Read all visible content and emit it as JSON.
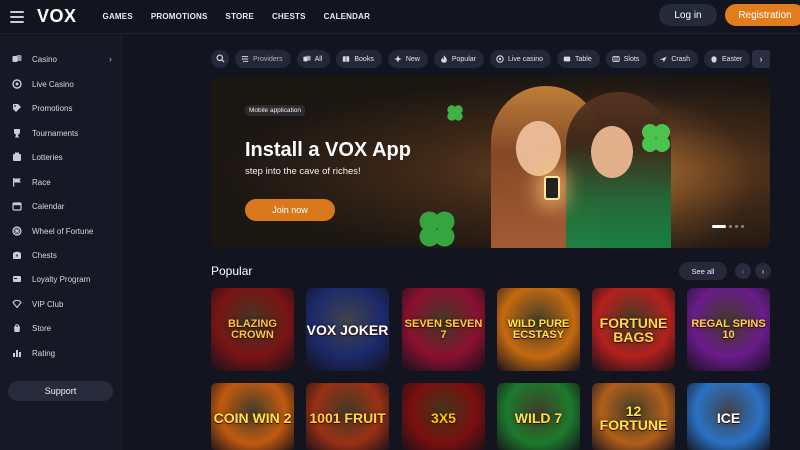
{
  "header": {
    "logo": "VOX",
    "nav": [
      "GAMES",
      "PROMOTIONS",
      "STORE",
      "CHESTS",
      "CALENDAR"
    ],
    "login_label": "Log in",
    "register_label": "Registration"
  },
  "sidebar": {
    "items": [
      {
        "label": "Casino",
        "icon": "casino-icon"
      },
      {
        "label": "Live Casino",
        "icon": "live-casino-icon"
      },
      {
        "label": "Promotions",
        "icon": "promotions-icon"
      },
      {
        "label": "Tournaments",
        "icon": "trophy-icon"
      },
      {
        "label": "Lotteries",
        "icon": "lottery-icon"
      },
      {
        "label": "Race",
        "icon": "flag-icon"
      },
      {
        "label": "Calendar",
        "icon": "calendar-icon"
      },
      {
        "label": "Wheel of Fortune",
        "icon": "wheel-icon"
      },
      {
        "label": "Chests",
        "icon": "chest-icon"
      },
      {
        "label": "Loyalty Program",
        "icon": "loyalty-icon"
      },
      {
        "label": "VIP Club",
        "icon": "diamond-icon"
      },
      {
        "label": "Store",
        "icon": "store-icon"
      },
      {
        "label": "Rating",
        "icon": "rating-icon"
      }
    ],
    "support_label": "Support"
  },
  "filters": {
    "providers_label": "Providers",
    "chips": [
      "All",
      "Books",
      "New",
      "Popular",
      "Live casino",
      "Table",
      "Slots",
      "Crash",
      "Easter"
    ]
  },
  "banner": {
    "badge": "Mobile application",
    "title": "Install a VOX App",
    "subtitle": "step into the cave of riches!",
    "button_label": "Join now"
  },
  "popular": {
    "title": "Popular",
    "see_all_label": "See all",
    "games_row1": [
      {
        "name": "Blazing Crown",
        "bg": "#7a1414",
        "fg": "#f5c542"
      },
      {
        "name": "Vox Joker",
        "bg": "#1b2a6b",
        "fg": "#ffffff"
      },
      {
        "name": "Seven Seven 7",
        "bg": "#8a1030",
        "fg": "#ffcf40"
      },
      {
        "name": "Wild Pure Ecstasy",
        "bg": "#c46a10",
        "fg": "#ffe24a"
      },
      {
        "name": "Fortune Bags",
        "bg": "#b4201c",
        "fg": "#ffd84a"
      },
      {
        "name": "Regal Spins 10",
        "bg": "#6a1c8a",
        "fg": "#ffd24a"
      }
    ],
    "games_row2": [
      {
        "name": "Coin Win 2",
        "bg": "#c25a10",
        "fg": "#ffe14a"
      },
      {
        "name": "1001 Fruit",
        "bg": "#9a3014",
        "fg": "#ffd24a"
      },
      {
        "name": "3x5",
        "bg": "#7a0f0f",
        "fg": "#ffc400"
      },
      {
        "name": "Wild 7",
        "bg": "#1c7a2c",
        "fg": "#ffe14a"
      },
      {
        "name": "12 Fortune",
        "bg": "#b0601a",
        "fg": "#ffe14a"
      },
      {
        "name": "Ice",
        "bg": "#2a72c4",
        "fg": "#ffffff"
      }
    ]
  }
}
